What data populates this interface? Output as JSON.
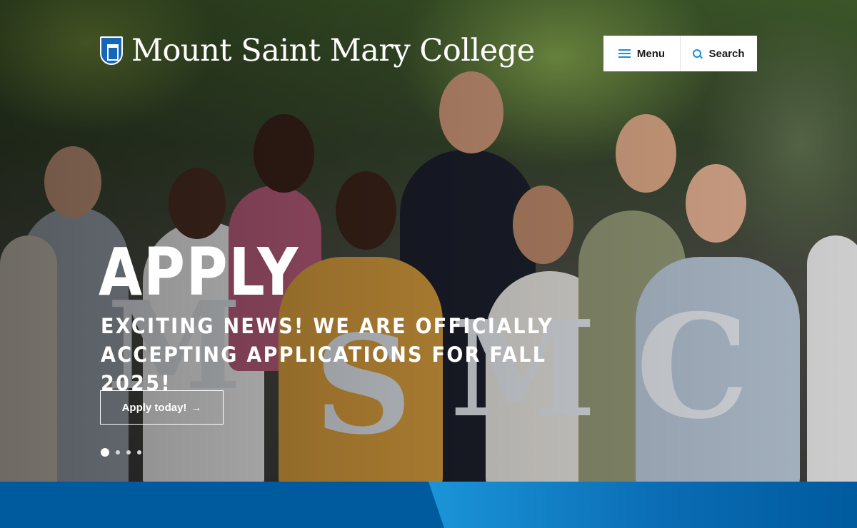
{
  "brand": {
    "name": "Mount Saint Mary College",
    "primary_color": "#005a9e",
    "accent_color": "#1a8fd6"
  },
  "header": {
    "menu_label": "Menu",
    "menu_icon": "hamburger-icon",
    "search_label": "Search",
    "search_icon": "search-icon"
  },
  "hero": {
    "title": "APPLY",
    "subtitle": "EXCITING NEWS! WE ARE OFFICIALLY ACCEPTING APPLICATIONS FOR FALL 2025!",
    "cta_label": "Apply today!",
    "cta_icon": "arrow-right-icon",
    "photo_letters": [
      "M",
      "S",
      "M",
      "C"
    ],
    "slides_total": 4,
    "active_slide": 1
  }
}
